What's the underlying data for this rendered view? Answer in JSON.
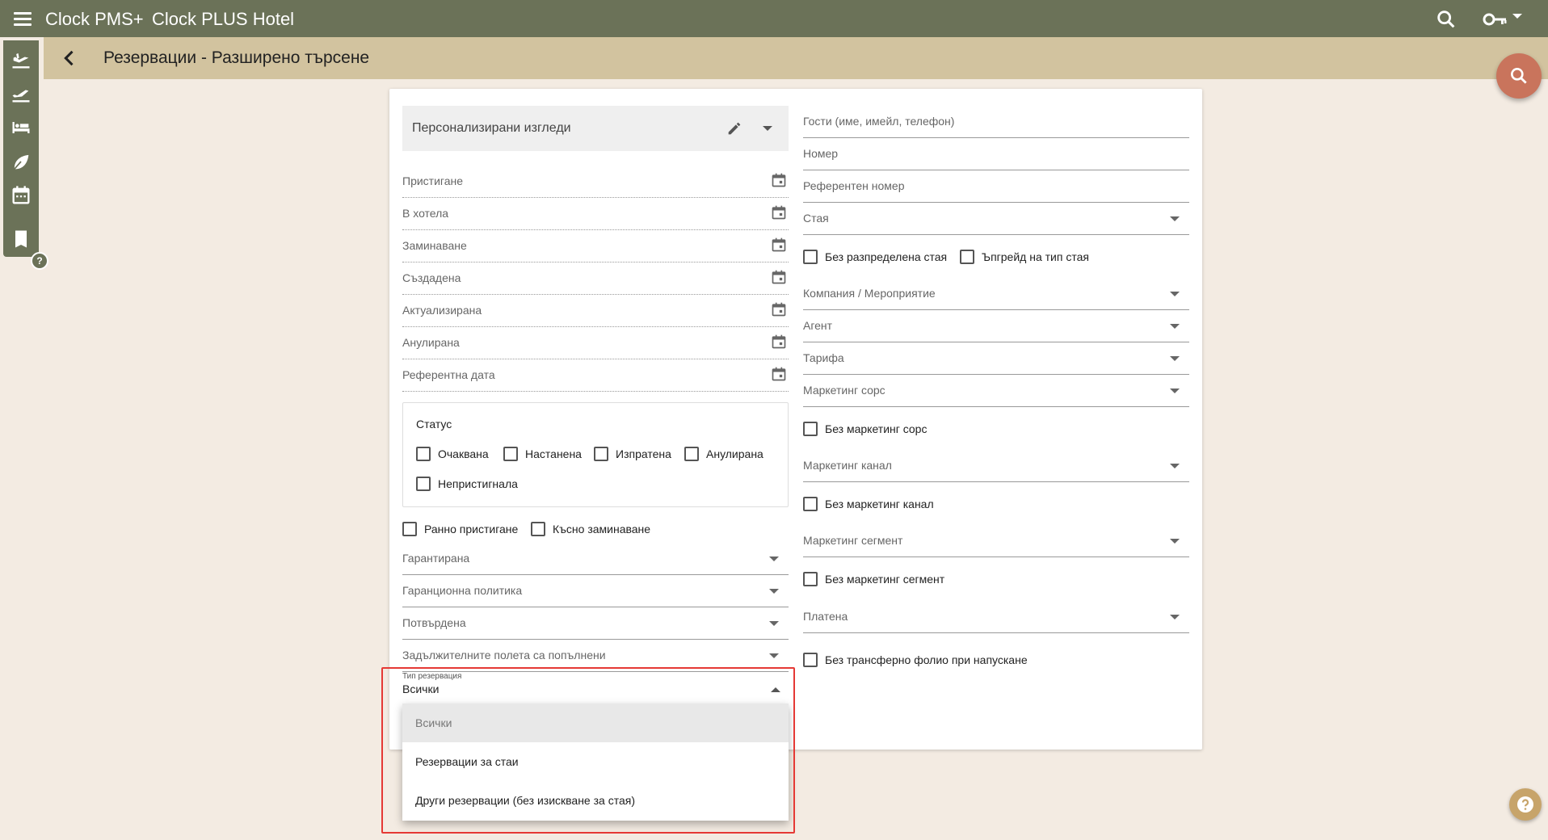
{
  "topbar": {
    "app_name": "Clock PMS+",
    "hotel_name": "Clock PLUS Hotel"
  },
  "subheader": {
    "title": "Резервации - Разширено търсене"
  },
  "views": {
    "label": "Персонализирани изгледи"
  },
  "left_fields": {
    "arrival": "Пристигане",
    "in_hotel": "В хотела",
    "departure": "Заминаване",
    "created": "Създадена",
    "updated": "Актуализирана",
    "cancelled": "Анулирана",
    "reference_date": "Референтна дата"
  },
  "status": {
    "title": "Статус",
    "options": [
      "Очаквана",
      "Настанена",
      "Изпратена",
      "Анулирана",
      "Непристигнала"
    ]
  },
  "flags": {
    "early_arrival": "Ранно пристигане",
    "late_departure": "Късно заминаване"
  },
  "left_selects": {
    "guaranteed": "Гарантирана",
    "guarantee_policy": "Гаранционна политика",
    "confirmed": "Потвърдена",
    "required_filled": "Задължителните полета са попълнени"
  },
  "reservation_type": {
    "label": "Тип резервация",
    "value": "Всички",
    "options": [
      "Всички",
      "Резервации за стаи",
      "Други резервации (без изискване за стая)"
    ]
  },
  "right_fields": {
    "guests": "Гости (име, имейл, телефон)",
    "number": "Номер",
    "reference_number": "Референтен номер",
    "room": "Стая",
    "no_assigned_room": "Без разпределена стая",
    "room_type_upgrade": "Ъпгрейд на тип стая",
    "company_event": "Компания / Мероприятие",
    "agent": "Агент",
    "rate": "Тарифа",
    "marketing_source": "Маркетинг сорс",
    "no_marketing_source": "Без маркетинг сорс",
    "marketing_channel": "Маркетинг канал",
    "no_marketing_channel": "Без маркетинг канал",
    "marketing_segment": "Маркетинг сегмент",
    "no_marketing_segment": "Без маркетинг сегмент",
    "paid": "Платена",
    "no_transfer_folio": "Без трансферно фолио при напускане"
  },
  "colors": {
    "topbar": "#6b7258",
    "subheader": "#d2c39f",
    "background": "#f3ebe2",
    "fab": "#c9745c",
    "highlight": "#e53935"
  },
  "icons": {
    "rail": [
      "arrival-icon",
      "departure-icon",
      "bed-icon",
      "leaf-icon",
      "calendar-icon",
      "book-icon"
    ]
  }
}
